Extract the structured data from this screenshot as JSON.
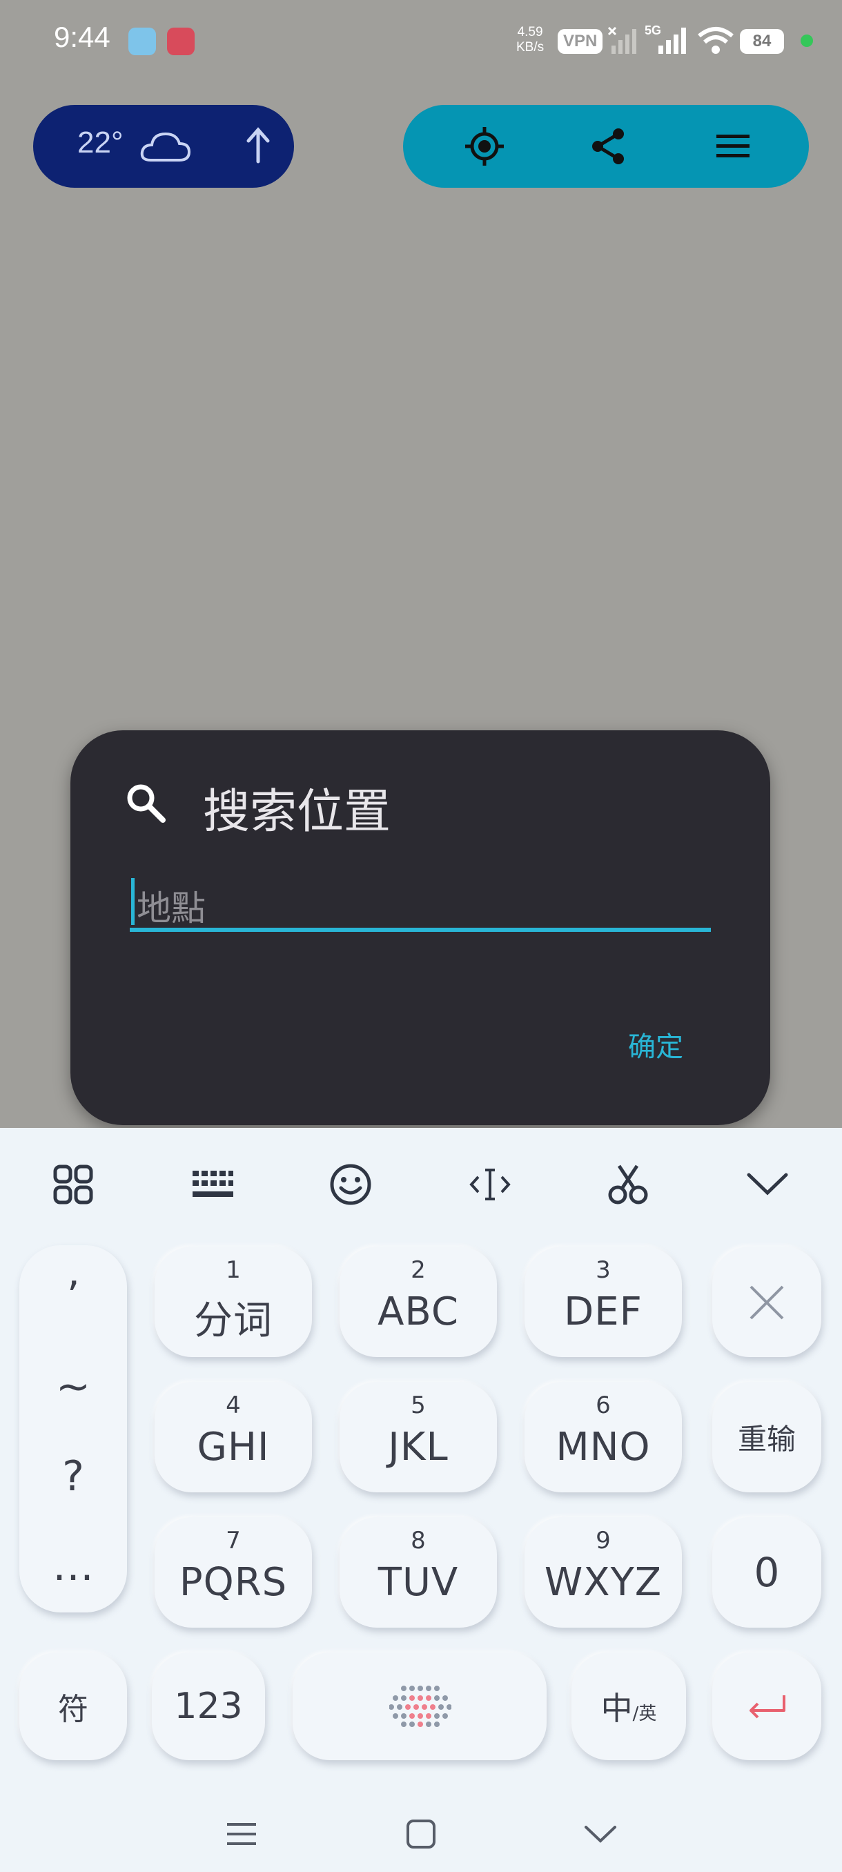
{
  "status_bar": {
    "time": "9:44",
    "speed_value": "4.59",
    "speed_unit": "KB/s",
    "vpn": "VPN",
    "network": "5G",
    "battery": "84",
    "colors": {
      "dot": "#34c759"
    }
  },
  "weather": {
    "temperature": "22°",
    "icon": "cloud-icon",
    "arrow": "arrow-up-icon"
  },
  "actions": [
    {
      "icon": "locate-icon"
    },
    {
      "icon": "share-icon"
    },
    {
      "icon": "menu-icon"
    }
  ],
  "dialog": {
    "title": "搜索位置",
    "input_placeholder": "地點",
    "input_value": "",
    "confirm_label": "确定",
    "colors": {
      "accent": "#29b6d6",
      "background": "#2b2a31"
    }
  },
  "keyboard": {
    "toolbar": [
      "grid-icon",
      "keyboard-icon",
      "emoji-icon",
      "cursor-icon",
      "scissors-icon",
      "collapse-icon"
    ],
    "side_column": [
      "’",
      "~",
      "?",
      "…"
    ],
    "keys": [
      {
        "num": "1",
        "letters": "分词"
      },
      {
        "num": "2",
        "letters": "ABC"
      },
      {
        "num": "3",
        "letters": "DEF"
      },
      {
        "num": "4",
        "letters": "GHI"
      },
      {
        "num": "5",
        "letters": "JKL"
      },
      {
        "num": "6",
        "letters": "MNO"
      },
      {
        "num": "7",
        "letters": "PQRS"
      },
      {
        "num": "8",
        "letters": "TUV"
      },
      {
        "num": "9",
        "letters": "WXYZ"
      }
    ],
    "delete_icon": "close-icon",
    "retype": "重输",
    "zero": "0",
    "symbol": "符",
    "num_mode": "123",
    "space_icon": "voice-dots-icon",
    "lang_main": "中",
    "lang_sub": "/英",
    "enter_icon": "enter-icon"
  },
  "nav_bar": [
    "menu-lines-icon",
    "home-square-icon",
    "back-chevron-icon"
  ]
}
